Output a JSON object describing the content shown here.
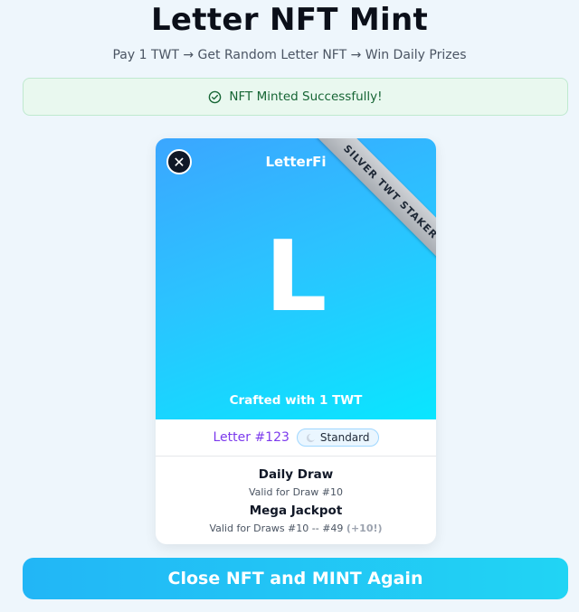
{
  "header": {
    "title": "Letter NFT Mint",
    "subtitle": "Pay 1 TWT → Get Random Letter NFT → Win Daily Prizes"
  },
  "status": {
    "message": "NFT Minted Successfully!",
    "icon": "check-circle-icon",
    "color": "#166534"
  },
  "card": {
    "close_icon": "close-icon",
    "close_symbol": "✕",
    "brand": "LetterFi",
    "ribbon": "SILVER TWT STAKER",
    "letter": "L",
    "crafted": "Crafted with 1 TWT",
    "letter_id": "Letter #123",
    "rarity": "Standard",
    "rarity_icon": "moon-icon",
    "daily_title": "Daily Draw",
    "daily_sub": "Valid for Draw #10",
    "jackpot_title": "Mega Jackpot",
    "jackpot_sub": "Valid for Draws #10 -- #49",
    "jackpot_bonus": "(+10!)"
  },
  "actions": {
    "primary_label": "Close NFT and MINT Again"
  },
  "colors": {
    "accent": "#22b6f6",
    "letter_id": "#7c3aed",
    "success_bg": "#e9f8ef"
  }
}
